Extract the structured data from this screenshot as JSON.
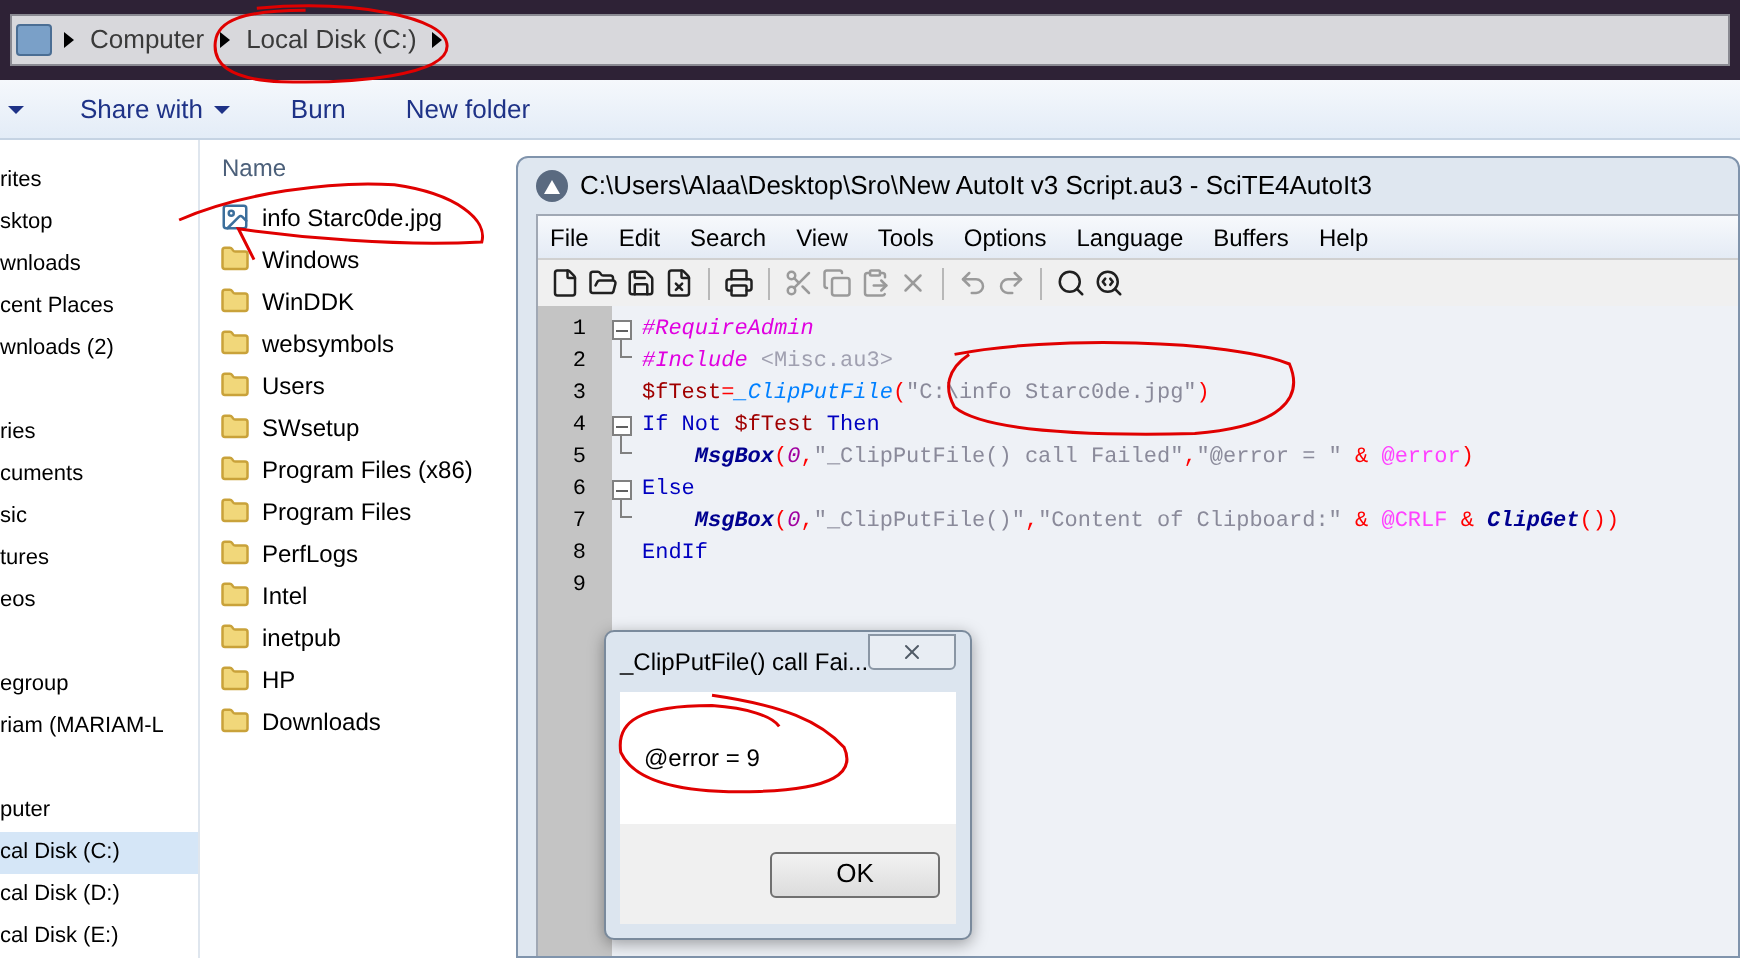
{
  "breadcrumb": {
    "items": [
      "Computer",
      "Local Disk (C:)"
    ]
  },
  "toolbar": {
    "items": [
      {
        "label": "Share with",
        "dropdown": true
      },
      {
        "label": "Burn",
        "dropdown": false
      },
      {
        "label": "New folder",
        "dropdown": false
      }
    ]
  },
  "nav_pane": {
    "groups": [
      {
        "items": [
          {
            "label": "rites",
            "selected": false
          },
          {
            "label": "sktop",
            "selected": false
          },
          {
            "label": "wnloads",
            "selected": false
          },
          {
            "label": "cent Places",
            "selected": false
          },
          {
            "label": "wnloads (2)",
            "selected": false
          }
        ]
      },
      {
        "items": [
          {
            "label": "ries",
            "selected": false
          },
          {
            "label": "cuments",
            "selected": false
          },
          {
            "label": "sic",
            "selected": false
          },
          {
            "label": "tures",
            "selected": false
          },
          {
            "label": "eos",
            "selected": false
          }
        ]
      },
      {
        "items": [
          {
            "label": "egroup",
            "selected": false
          },
          {
            "label": "riam (MARIAM-L",
            "selected": false
          }
        ]
      },
      {
        "items": [
          {
            "label": "puter",
            "selected": false
          },
          {
            "label": "cal Disk (C:)",
            "selected": true
          },
          {
            "label": "cal Disk (D:)",
            "selected": false
          },
          {
            "label": "cal Disk (E:)",
            "selected": false
          }
        ]
      }
    ]
  },
  "file_list": {
    "column": "Name",
    "items": [
      {
        "name": "info Starc0de.jpg",
        "kind": "image"
      },
      {
        "name": "Windows",
        "kind": "folder"
      },
      {
        "name": "WinDDK",
        "kind": "folder"
      },
      {
        "name": "websymbols",
        "kind": "folder"
      },
      {
        "name": "Users",
        "kind": "folder"
      },
      {
        "name": "SWsetup",
        "kind": "folder"
      },
      {
        "name": "Program Files (x86)",
        "kind": "folder"
      },
      {
        "name": "Program Files",
        "kind": "folder"
      },
      {
        "name": "PerfLogs",
        "kind": "folder"
      },
      {
        "name": "Intel",
        "kind": "folder"
      },
      {
        "name": "inetpub",
        "kind": "folder"
      },
      {
        "name": "HP",
        "kind": "folder"
      },
      {
        "name": "Downloads",
        "kind": "folder"
      }
    ]
  },
  "editor": {
    "title": "C:\\Users\\Alaa\\Desktop\\Sro\\New AutoIt v3 Script.au3 - SciTE4AutoIt3",
    "menu": [
      "File",
      "Edit",
      "Search",
      "View",
      "Tools",
      "Options",
      "Language",
      "Buffers",
      "Help"
    ],
    "lines": [
      {
        "number": "1",
        "fold_start": true,
        "fold_end": false,
        "tokens": [
          {
            "text": "#RequireAdmin",
            "kind": "directive"
          }
        ]
      },
      {
        "number": "2",
        "fold_start": false,
        "fold_end": true,
        "tokens": [
          {
            "text": "#Include ",
            "kind": "directive"
          },
          {
            "text": "<Misc.au3>",
            "kind": "include"
          }
        ]
      },
      {
        "number": "3",
        "fold_start": false,
        "fold_end": false,
        "tokens": [
          {
            "text": "$fTest",
            "kind": "variable"
          },
          {
            "text": "=",
            "kind": "operator"
          },
          {
            "text": "_ClipPutFile",
            "kind": "udf"
          },
          {
            "text": "(",
            "kind": "operator"
          },
          {
            "text": "\"C:\\info Starc0de.jpg\"",
            "kind": "string"
          },
          {
            "text": ")",
            "kind": "operator"
          }
        ]
      },
      {
        "number": "4",
        "fold_start": true,
        "fold_end": false,
        "tokens": [
          {
            "text": "If Not ",
            "kind": "keyword"
          },
          {
            "text": "$fTest",
            "kind": "variable"
          },
          {
            "text": " Then",
            "kind": "keyword"
          }
        ]
      },
      {
        "number": "5",
        "fold_start": false,
        "fold_end": true,
        "tokens": [
          {
            "text": "    MsgBox",
            "kind": "function"
          },
          {
            "text": "(",
            "kind": "operator"
          },
          {
            "text": "0",
            "kind": "number"
          },
          {
            "text": ",",
            "kind": "operator"
          },
          {
            "text": "\"_ClipPutFile() call Failed\"",
            "kind": "string"
          },
          {
            "text": ",",
            "kind": "operator"
          },
          {
            "text": "\"@error = \"",
            "kind": "string"
          },
          {
            "text": " & ",
            "kind": "operator"
          },
          {
            "text": "@error",
            "kind": "macro"
          },
          {
            "text": ")",
            "kind": "operator"
          }
        ]
      },
      {
        "number": "6",
        "fold_start": true,
        "fold_end": false,
        "tokens": [
          {
            "text": "Else",
            "kind": "keyword"
          }
        ]
      },
      {
        "number": "7",
        "fold_start": false,
        "fold_end": true,
        "tokens": [
          {
            "text": "    MsgBox",
            "kind": "function"
          },
          {
            "text": "(",
            "kind": "operator"
          },
          {
            "text": "0",
            "kind": "number"
          },
          {
            "text": ",",
            "kind": "operator"
          },
          {
            "text": "\"_ClipPutFile()\"",
            "kind": "string"
          },
          {
            "text": ",",
            "kind": "operator"
          },
          {
            "text": "\"Content of Clipboard:\"",
            "kind": "string"
          },
          {
            "text": " & ",
            "kind": "operator"
          },
          {
            "text": "@CRLF",
            "kind": "macro"
          },
          {
            "text": " & ",
            "kind": "operator"
          },
          {
            "text": "ClipGet",
            "kind": "function"
          },
          {
            "text": "())",
            "kind": "operator"
          }
        ]
      },
      {
        "number": "8",
        "fold_start": false,
        "fold_end": false,
        "tokens": [
          {
            "text": "EndIf",
            "kind": "keyword"
          }
        ]
      },
      {
        "number": "9",
        "fold_start": false,
        "fold_end": false
      }
    ]
  },
  "message_box": {
    "title": "_ClipPutFile() call Fai...",
    "message": "@error = 9",
    "button": "OK"
  }
}
